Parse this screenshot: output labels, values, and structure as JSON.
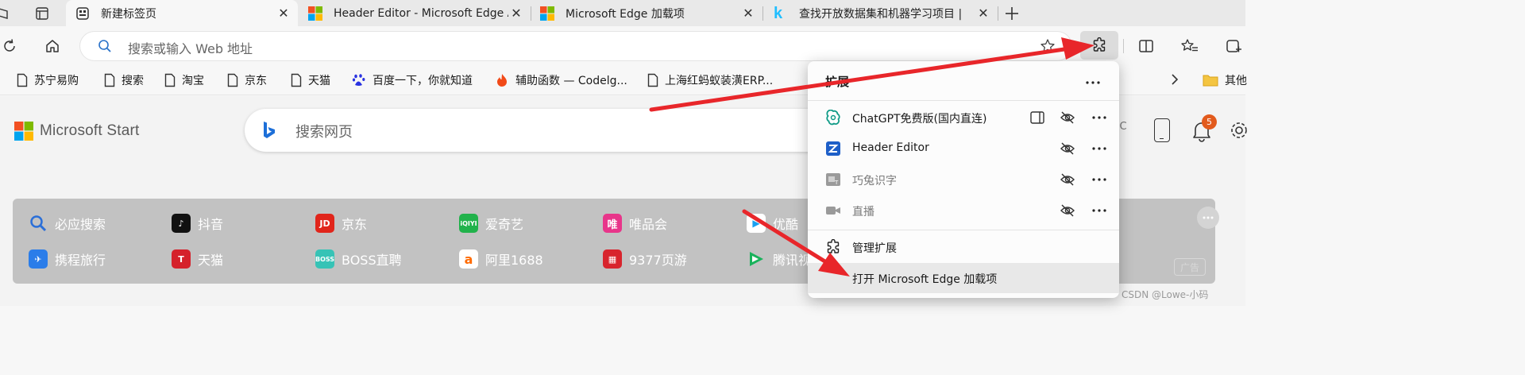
{
  "tabs": [
    {
      "title": "新建标签页",
      "active": true
    },
    {
      "title": "Header Editor - Microsoft Edge A",
      "active": false
    },
    {
      "title": "Microsoft Edge 加载项",
      "active": false
    },
    {
      "title": "查找开放数据集和机器学习项目 |",
      "active": false
    }
  ],
  "toolbar": {
    "address_placeholder": "搜索或输入 Web 地址"
  },
  "favorites": [
    {
      "label": "苏宁易购",
      "icon": "page-icon"
    },
    {
      "label": "搜索",
      "icon": "page-icon"
    },
    {
      "label": "淘宝",
      "icon": "page-icon"
    },
    {
      "label": "京东",
      "icon": "page-icon"
    },
    {
      "label": "天猫",
      "icon": "page-icon"
    },
    {
      "label": "百度一下，你就知道",
      "icon": "baidu-icon"
    },
    {
      "label": "辅助函数 — Codelg...",
      "icon": "flame-icon"
    },
    {
      "label": "上海红蚂蚁装潢ERP...",
      "icon": "page-icon"
    }
  ],
  "favorites_other": "其他",
  "page": {
    "logo_text": "Microsoft Start",
    "search_placeholder": "搜索网页",
    "weather_unit": "°C",
    "notification_count": "5",
    "quick_links_row1": [
      {
        "label": "必应搜索",
        "color": "#2b6fd8"
      },
      {
        "label": "抖音",
        "color": "#111111"
      },
      {
        "label": "京东",
        "color": "#e1251b"
      },
      {
        "label": "爱奇艺",
        "color": "#21b24b"
      },
      {
        "label": "唯品会",
        "color": "#e8358a"
      },
      {
        "label": "优酷",
        "color": "#1aa0f0"
      }
    ],
    "quick_links_row2": [
      {
        "label": "携程旅行",
        "color": "#2b7de9"
      },
      {
        "label": "天猫",
        "color": "#d5212b"
      },
      {
        "label": "BOSS直聘",
        "color": "#36c3b6"
      },
      {
        "label": "阿里1688",
        "color": "#ff6a00"
      },
      {
        "label": "9377页游",
        "color": "#d8242d"
      },
      {
        "label": "腾讯视",
        "color": "#19b25b"
      }
    ],
    "ad_label": "广告",
    "watermark": "CSDN @Lowe-小码"
  },
  "extensions_popup": {
    "title": "扩展",
    "items": [
      {
        "name": "ChatGPT免费版(国内直连)",
        "enabled": true
      },
      {
        "name": "Header Editor",
        "enabled": true
      },
      {
        "name": "巧兔识字",
        "enabled": false
      },
      {
        "name": "直播",
        "enabled": false
      }
    ],
    "manage_label": "管理扩展",
    "open_addons_label": "打开 Microsoft Edge 加载项"
  },
  "colors": {
    "annotation_arrow": "#e8262a",
    "badge": "#e25a1c"
  }
}
